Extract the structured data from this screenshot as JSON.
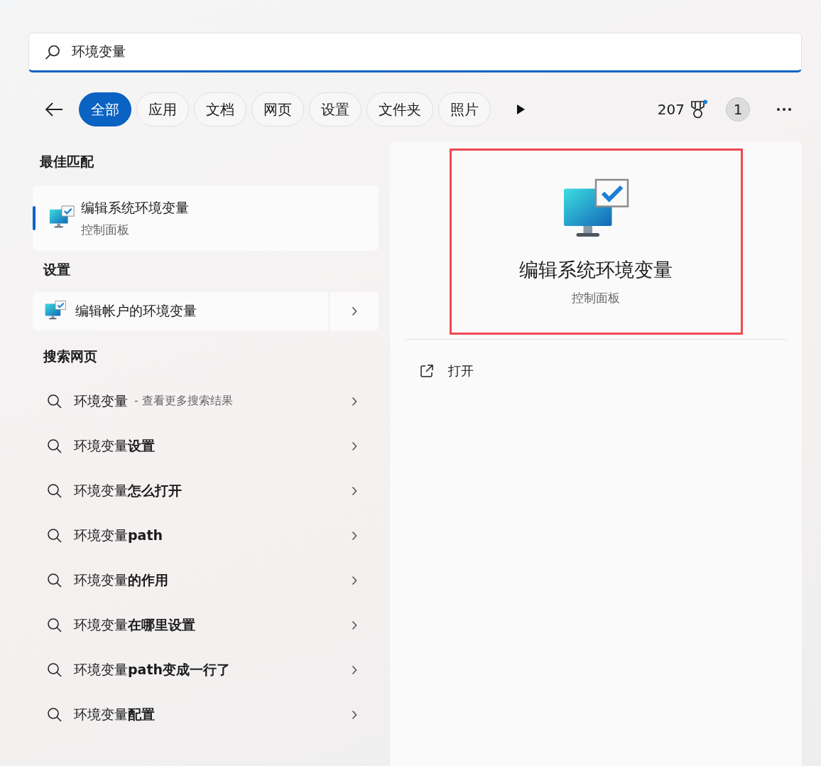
{
  "search": {
    "value": "环境变量"
  },
  "filters": [
    {
      "label": "全部",
      "selected": true
    },
    {
      "label": "应用",
      "selected": false
    },
    {
      "label": "文档",
      "selected": false
    },
    {
      "label": "网页",
      "selected": false
    },
    {
      "label": "设置",
      "selected": false
    },
    {
      "label": "文件夹",
      "selected": false
    },
    {
      "label": "照片",
      "selected": false
    }
  ],
  "points": "207",
  "account_badge": "1",
  "best_match": {
    "heading": "最佳匹配",
    "items": [
      {
        "title": "编辑系统环境变量",
        "subtitle": "控制面板",
        "selected": true
      }
    ]
  },
  "settings": {
    "heading": "设置",
    "items": [
      {
        "title": "编辑帐户的环境变量",
        "selected": false
      }
    ]
  },
  "web": {
    "heading": "搜索网页",
    "items": [
      {
        "text": "环境变量",
        "hint": " - 查看更多搜索结果"
      },
      {
        "text": "环境变量**设置**"
      },
      {
        "text": "环境变量**怎么打开**"
      },
      {
        "text": "环境变量**path**"
      },
      {
        "text": "环境变量**的作用**"
      },
      {
        "text": "环境变量**在哪里设置**"
      },
      {
        "text": "环境变量**path变成一行了**"
      },
      {
        "text": "环境变量**配置**"
      }
    ]
  },
  "preview": {
    "title": "编辑系统环境变量",
    "subtitle": "控制面板",
    "actions": [
      {
        "label": "打开"
      }
    ]
  }
}
